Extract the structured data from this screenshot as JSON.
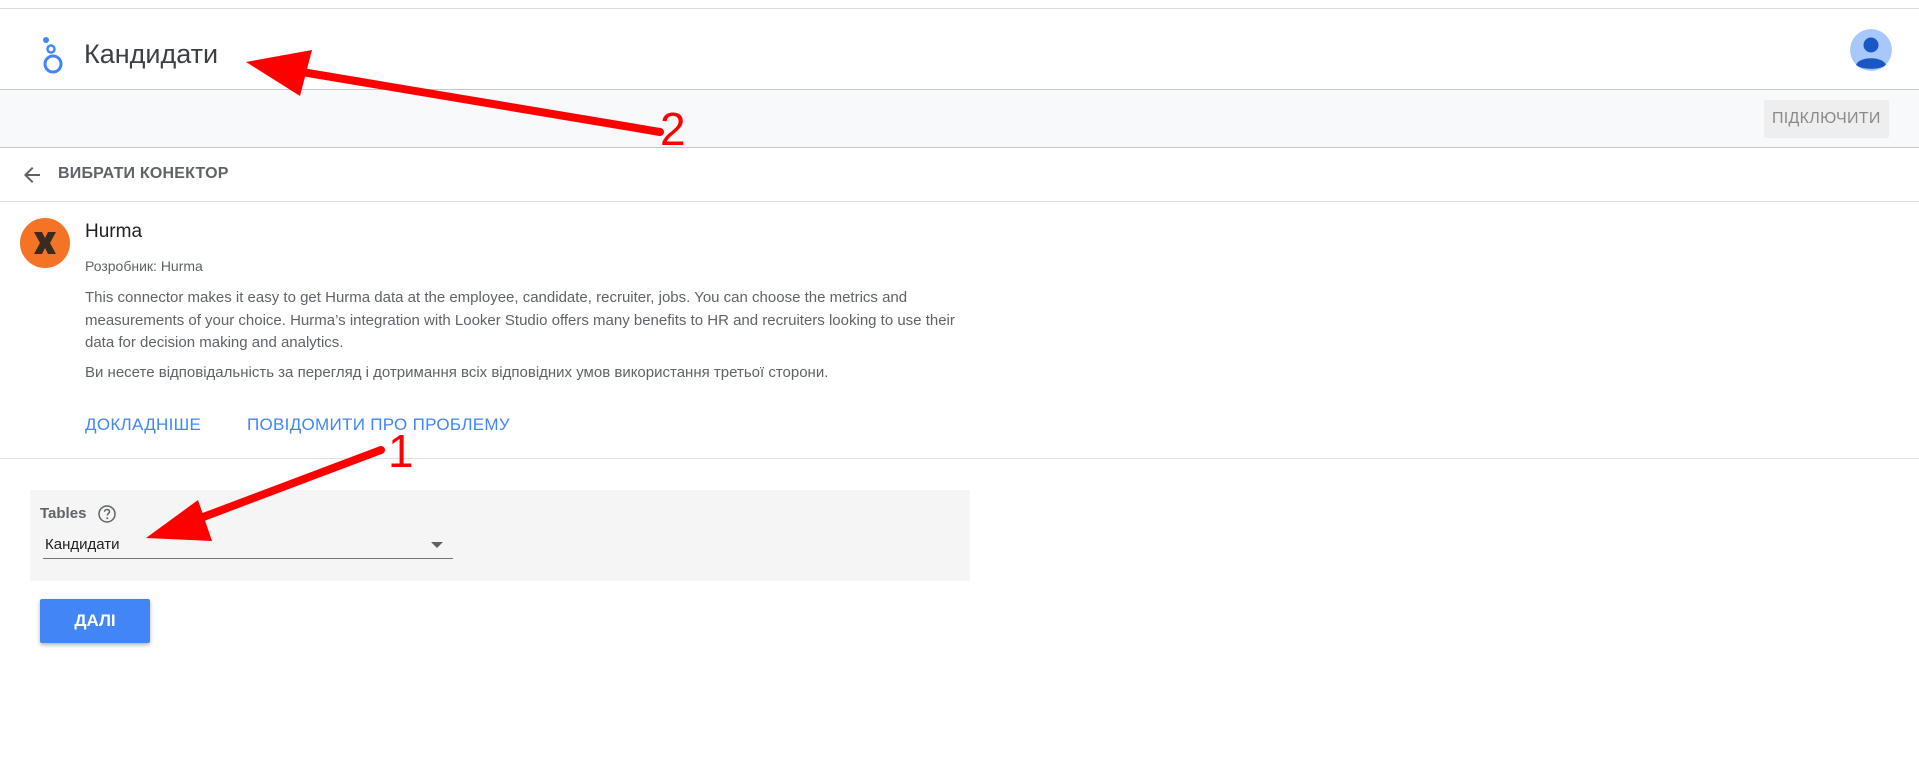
{
  "header": {
    "title": "Кандидати",
    "logo_icon": "looker-studio-logo-icon",
    "avatar_icon": "user-avatar-icon",
    "accent_color": "#4285f4"
  },
  "toolbar": {
    "connect_label": "ПІДКЛЮЧИТИ"
  },
  "back": {
    "icon": "arrow-back-icon",
    "label": "ВИБРАТИ КОНЕКТОР"
  },
  "connector": {
    "name": "Hurma",
    "developer": "Розробник: Hurma",
    "description": "This connector makes it easy to get Hurma data at the employee, candidate, recruiter, jobs. You can choose the metrics and measurements of your choice. Hurma’s integration with Looker Studio offers many benefits to HR and recruiters looking to use their data for decision making and analytics.",
    "responsibility": "Ви несете відповідальність за перегляд і дотримання всіх відповідних умов використання третьої сторони.",
    "links": {
      "learn_more": "ДОКЛАДНІШЕ",
      "report_issue": "ПОВІДОМИТИ ПРО ПРОБЛЕМУ"
    },
    "logo_color": "#f47325"
  },
  "params": {
    "tables_label": "Tables",
    "help_icon": "help-circle-icon",
    "selected_table": "Кандидати"
  },
  "actions": {
    "next_label": "ДАЛІ"
  },
  "annotations": {
    "arrow_1_number": "1",
    "arrow_2_number": "2",
    "color": "#ff0000"
  }
}
